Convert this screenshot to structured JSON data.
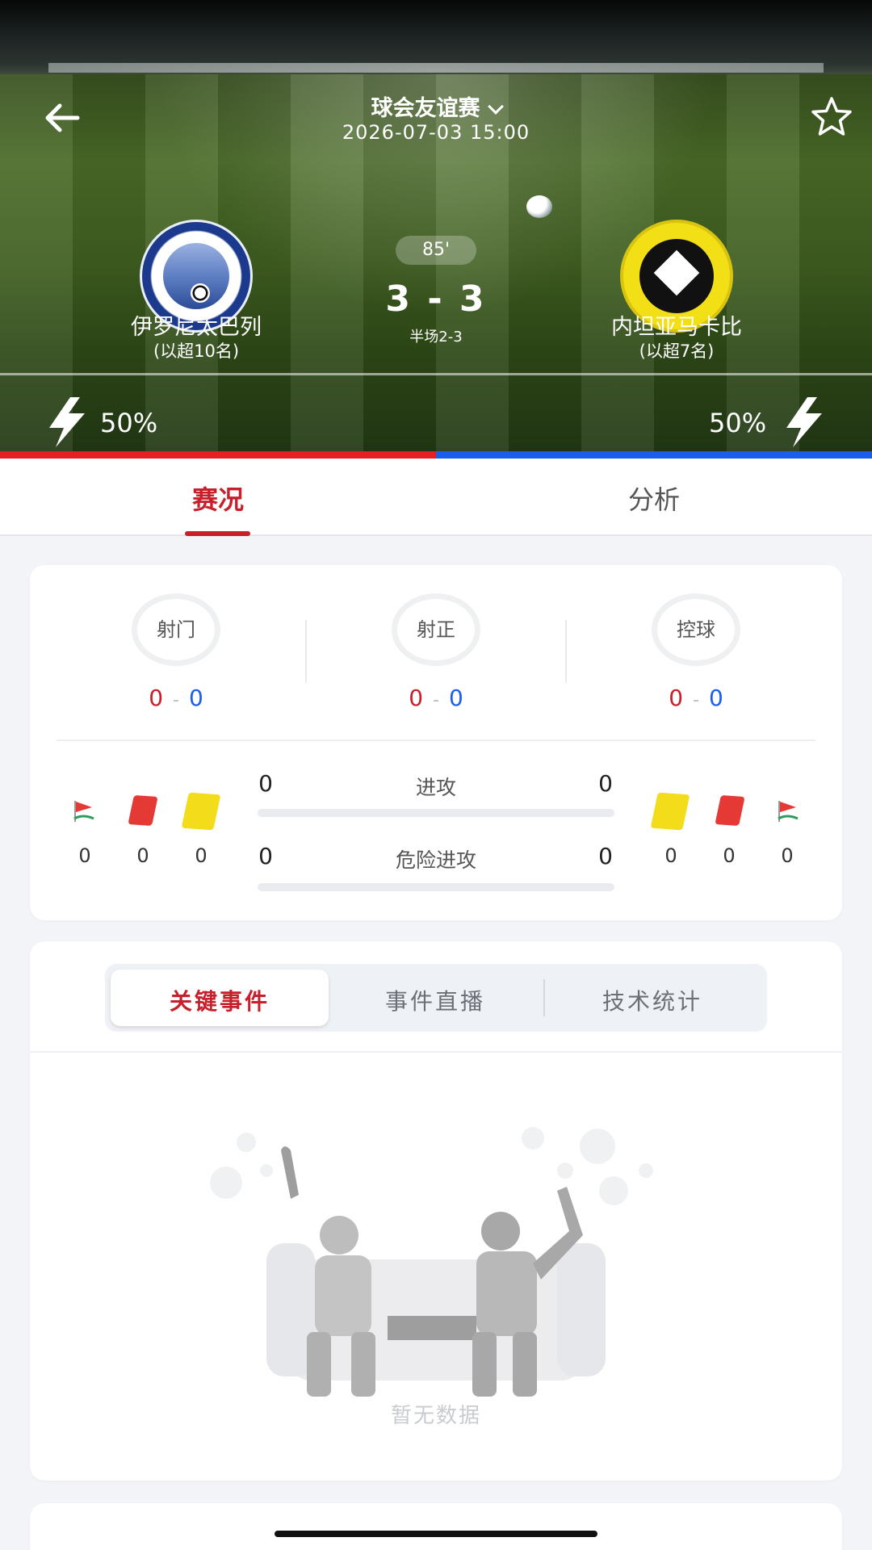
{
  "header": {
    "competition": "球会友谊赛",
    "datetime": "2026-07-03  15:00",
    "minute": "85'",
    "score": "3 - 3",
    "half_score": "半场2-3",
    "home": {
      "name": "伊罗尼太巴列",
      "rank": "(以超10名)",
      "momentum": "50%"
    },
    "away": {
      "name": "内坦亚马卡比",
      "rank": "(以超7名)",
      "momentum": "50%"
    },
    "possession_home_fraction": 0.5,
    "colors": {
      "home": "#e61f24",
      "away": "#1b5ded",
      "accent": "#c8202a"
    }
  },
  "tabs": {
    "live": "赛况",
    "analysis": "分析"
  },
  "stats": {
    "rings": [
      {
        "label": "射门",
        "home": "0",
        "away": "0",
        "dash": "-"
      },
      {
        "label": "射正",
        "home": "0",
        "away": "0",
        "dash": "-"
      },
      {
        "label": "控球",
        "home": "0",
        "away": "0",
        "dash": "-"
      }
    ],
    "home_counts": {
      "corners": "0",
      "red": "0",
      "yellow": "0"
    },
    "away_counts": {
      "yellow": "0",
      "red": "0",
      "corners": "0"
    },
    "attack": {
      "label": "进攻",
      "home": "0",
      "away": "0"
    },
    "dangerous_attack": {
      "label": "危险进攻",
      "home": "0",
      "away": "0"
    }
  },
  "events": {
    "segments": [
      "关键事件",
      "事件直播",
      "技术统计"
    ],
    "empty_text": "暂无数据"
  },
  "icons": [
    "back-arrow-icon",
    "star-icon",
    "chevron-down-icon",
    "lightning-icon",
    "corner-flag-icon",
    "red-card-icon",
    "yellow-card-icon"
  ]
}
